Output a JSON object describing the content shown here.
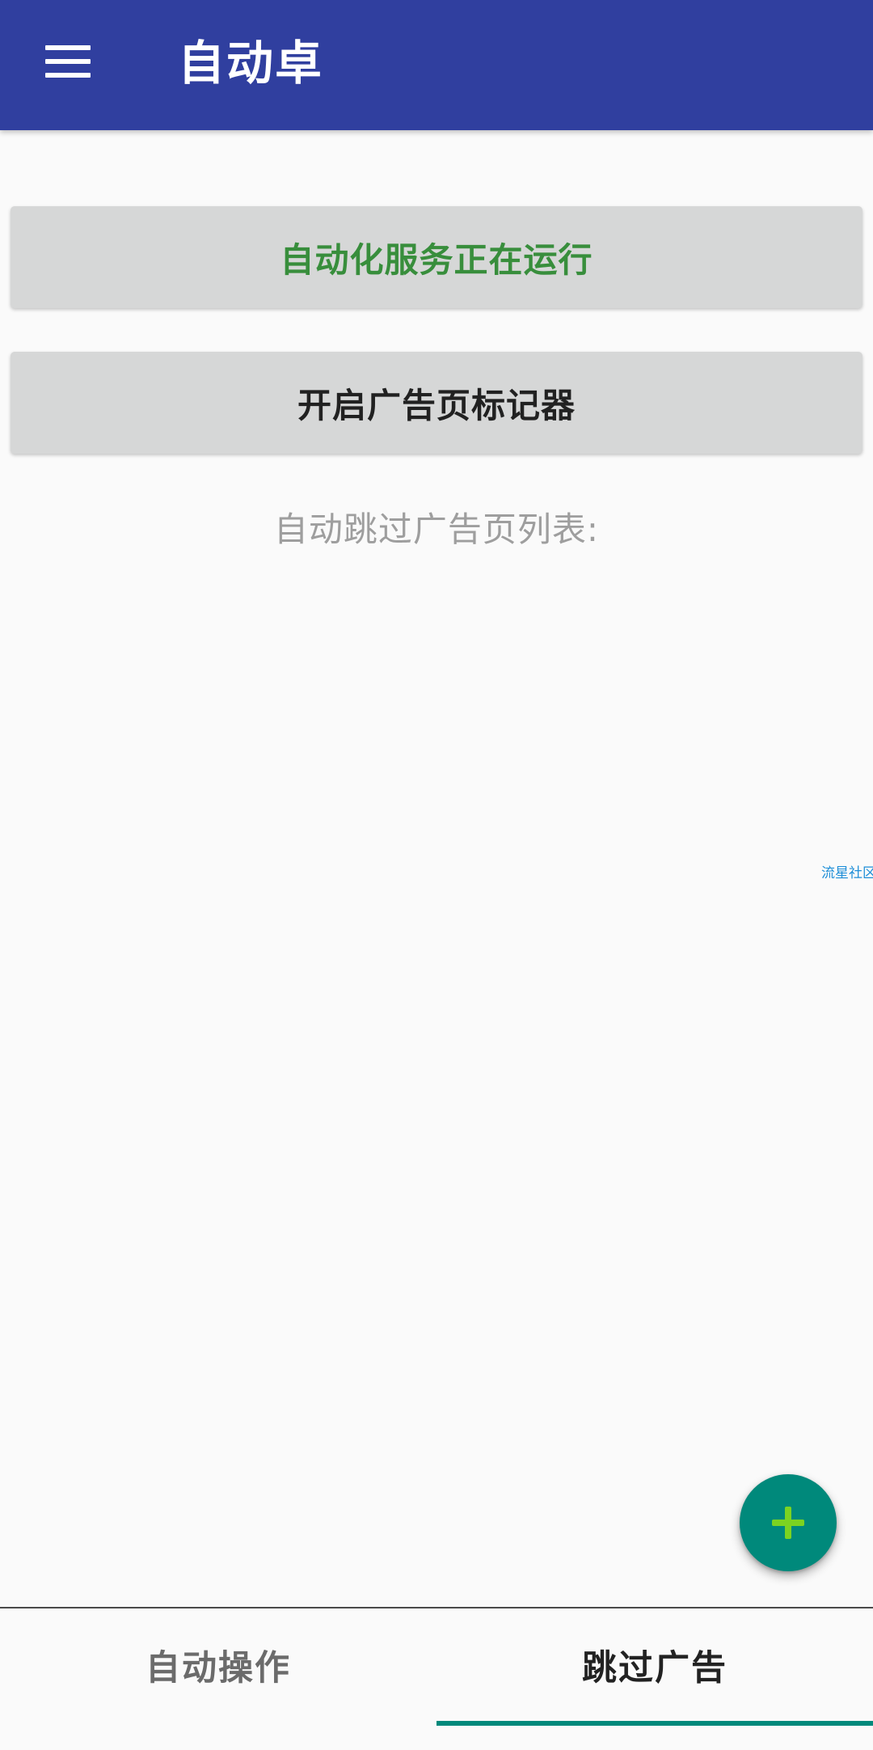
{
  "app_bar": {
    "title": "自动卓",
    "menu_icon": "hamburger-menu-icon",
    "background_color": "#303f9f"
  },
  "main": {
    "service_status_button": "自动化服务正在运行",
    "ad_marker_button": "开启广告页标记器",
    "list_label": "自动跳过广告页列表:",
    "status_color": "#388e3c"
  },
  "watermark": {
    "text": "流星社区"
  },
  "fab": {
    "icon": "plus-icon",
    "color": "#00897b"
  },
  "bottom_tabs": {
    "items": [
      {
        "label": "自动操作",
        "selected": false
      },
      {
        "label": "跳过广告",
        "selected": true
      }
    ],
    "indicator_color": "#00897b"
  }
}
